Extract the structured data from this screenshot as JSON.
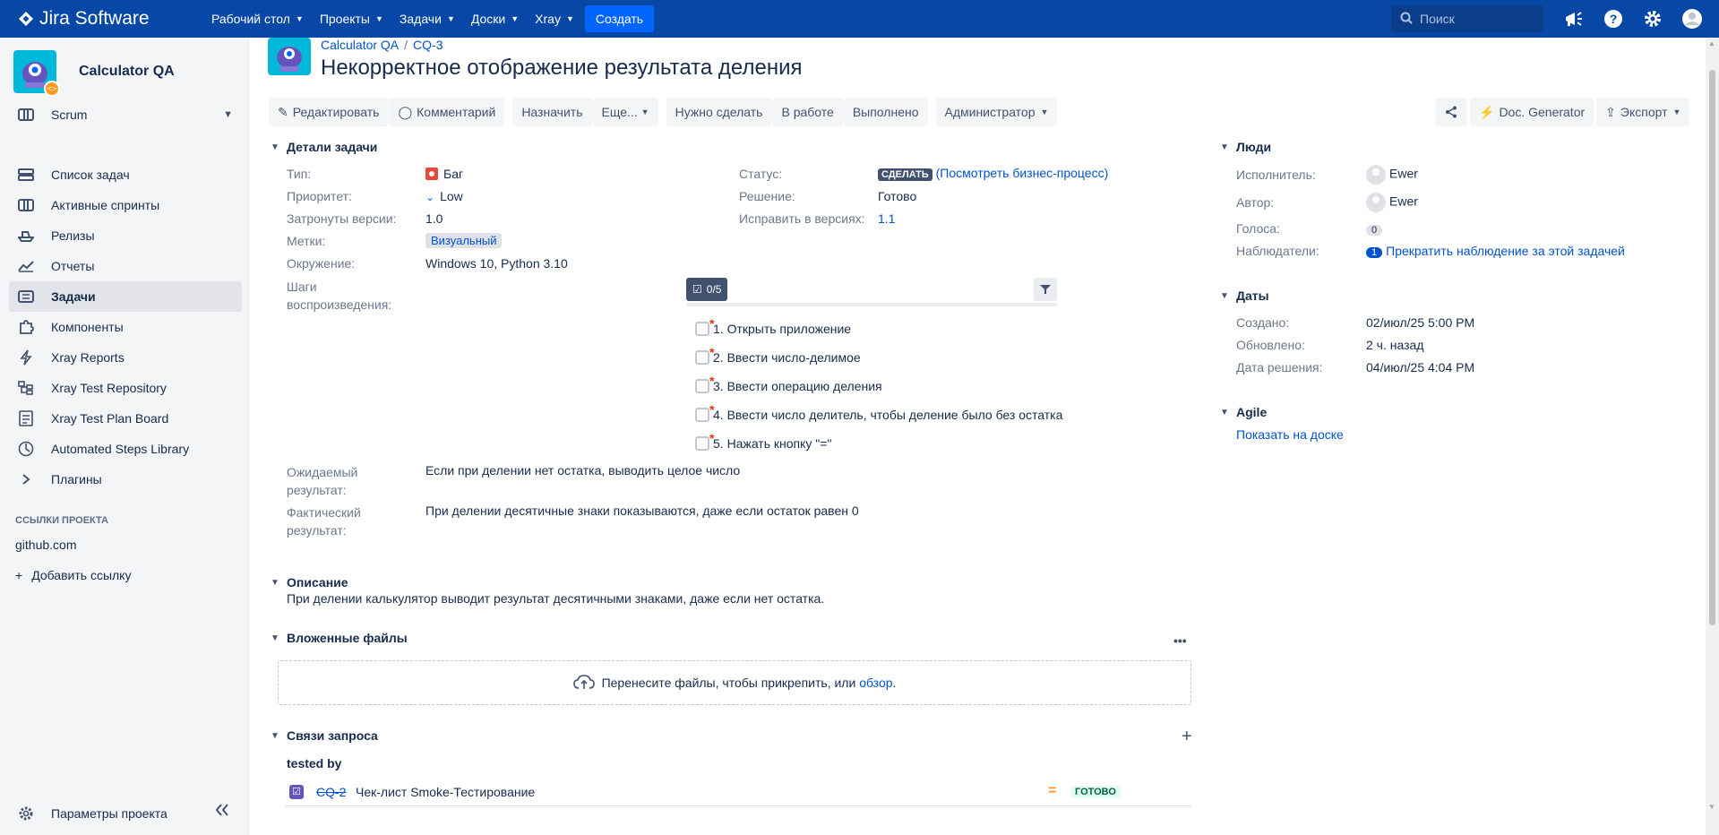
{
  "topnav": {
    "logo": "Jira Software",
    "items": [
      "Рабочий стол",
      "Проекты",
      "Задачи",
      "Доски",
      "Xray"
    ],
    "create": "Создать",
    "search_placeholder": "Поиск"
  },
  "sidebar": {
    "project_name": "Calculator QA",
    "board": "Scrum",
    "items": [
      {
        "label": "Список задач",
        "icon": "backlog-icon"
      },
      {
        "label": "Активные спринты",
        "icon": "board-icon"
      },
      {
        "label": "Релизы",
        "icon": "ship-icon"
      },
      {
        "label": "Отчеты",
        "icon": "chart-icon"
      },
      {
        "label": "Задачи",
        "icon": "issues-icon"
      },
      {
        "label": "Компоненты",
        "icon": "puzzle-icon"
      },
      {
        "label": "Xray Reports",
        "icon": "bolt-icon"
      },
      {
        "label": "Xray Test Repository",
        "icon": "repo-icon"
      },
      {
        "label": "Xray Test Plan Board",
        "icon": "plan-board-icon"
      },
      {
        "label": "Automated Steps Library",
        "icon": "library-icon"
      },
      {
        "label": "Плагины",
        "icon": "chevron-right-icon"
      }
    ],
    "links_caption": "ССЫЛКИ ПРОЕКТА",
    "link_github": "github.com",
    "add_link": "Добавить ссылку",
    "settings": "Параметры проекта"
  },
  "issue": {
    "breadcrumb_project": "Calculator QA",
    "breadcrumb_key": "CQ-3",
    "title": "Некорректное отображение результата деления"
  },
  "toolbar": {
    "edit": "Редактировать",
    "comment": "Комментарий",
    "assign": "Назначить",
    "more": "Еще...",
    "todo": "Нужно сделать",
    "in_progress": "В работе",
    "done": "Выполнено",
    "admin": "Администратор",
    "doc_generator": "Doc. Generator",
    "export": "Экспорт"
  },
  "details": {
    "section": "Детали задачи",
    "type_label": "Тип:",
    "type_value": "Баг",
    "priority_label": "Приоритет:",
    "priority_value": "Low",
    "affects_label": "Затронуты версии:",
    "affects_value": "1.0",
    "labels_label": "Метки:",
    "labels_value": "Визуальный",
    "env_label": "Окружение:",
    "env_value": "Windows 10, Python 3.10",
    "steps_label_1": "Шаги",
    "steps_label_2": "воспроизведения:",
    "status_label": "Статус:",
    "status_value": "СДЕЛАТЬ",
    "workflow_link": "(Посмотреть бизнес-процесс)",
    "resolution_label": "Решение:",
    "resolution_value": "Готово",
    "fix_label": "Исправить в версиях:",
    "fix_value": "1.1",
    "expected_label_1": "Ожидаемый",
    "expected_label_2": "результат:",
    "expected_value": "Если при делении нет остатка, выводить целое число",
    "actual_label_1": "Фактический",
    "actual_label_2": "результат:",
    "actual_value": "При делении десятичные знаки показываются, даже если остаток равен 0"
  },
  "checklist": {
    "progress": "0/5",
    "progress_fraction": 0,
    "items": [
      "1. Открыть приложение",
      "2. Ввести число-делимое",
      "3. Ввести операцию деления",
      "4. Ввести число делитель, чтобы деление было без остатка",
      "5. Нажать кнопку \"=\""
    ]
  },
  "description": {
    "section": "Описание",
    "text": "При делении калькулятор выводит результат десятичными знаками, даже если нет остатка."
  },
  "attachments": {
    "section": "Вложенные файлы",
    "drop_text": "Перенесите файлы, чтобы прикрепить, или",
    "browse": "обзор",
    "dot": "."
  },
  "links": {
    "section": "Связи запроса",
    "relation": "tested by",
    "key": "CQ-2",
    "summary": "Чек-лист Smoke-Тестирование",
    "status": "ГОТОВО"
  },
  "people": {
    "section": "Люди",
    "assignee_label": "Исполнитель:",
    "assignee": "Ewer",
    "reporter_label": "Автор:",
    "reporter": "Ewer",
    "votes_label": "Голоса:",
    "votes": "0",
    "watchers_label": "Наблюдатели:",
    "watchers": "1",
    "stop_watching": "Прекратить наблюдение за этой задачей"
  },
  "dates": {
    "section": "Даты",
    "created_label": "Создано:",
    "created": "02/июл/25 5:00 PM",
    "updated_label": "Обновлено:",
    "updated": "2 ч. назад",
    "resolved_label": "Дата решения:",
    "resolved": "04/июл/25 4:04 PM"
  },
  "agile": {
    "section": "Agile",
    "show_on_board": "Показать на доске"
  }
}
